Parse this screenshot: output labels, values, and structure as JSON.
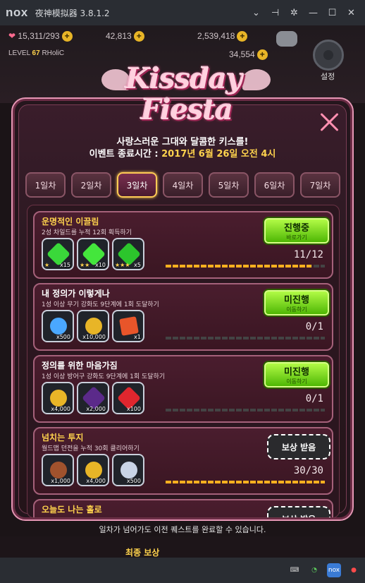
{
  "titlebar": {
    "logo": "nox",
    "title": "夜神模拟器 3.8.1.2",
    "icons": [
      "chevron-down-icon",
      "pin-icon",
      "gear-icon",
      "minimize-icon",
      "maximize-icon",
      "close-icon"
    ]
  },
  "hud": {
    "stamina": "15,311/293",
    "gold": "42,813",
    "gems": "2,539,418",
    "level_label": "LEVEL",
    "level": "67",
    "player_name": "RHoliC",
    "secondary": "34,554",
    "settings_label": "설정"
  },
  "modal": {
    "logo_line1": "Kissday",
    "logo_line2": "Fiesta",
    "subtitle": "사랑스러운 그대와 달콤한 키스를!",
    "event_end_label": "이벤트 종료시간 :",
    "event_end_date": "2017년 6월 26일 오전 4시",
    "tabs": [
      {
        "label": "1일차",
        "active": false
      },
      {
        "label": "2일차",
        "active": false
      },
      {
        "label": "3일차",
        "active": true
      },
      {
        "label": "4일차",
        "active": false
      },
      {
        "label": "5일차",
        "active": false
      },
      {
        "label": "6일차",
        "active": false
      },
      {
        "label": "7일차",
        "active": false
      }
    ],
    "quests": [
      {
        "title": "운명적인 이끌림",
        "title_gold": true,
        "desc": "2성 차일드를 누적 12회 획득하기",
        "rewards": [
          {
            "icon": "green-gem-icon",
            "qty": "x15",
            "stars": "★"
          },
          {
            "icon": "green-gem-icon",
            "qty": "x10",
            "stars": "★★"
          },
          {
            "icon": "green-gem-icon",
            "qty": "x5",
            "stars": "★★★"
          }
        ],
        "button": {
          "type": "green",
          "label": "진행중",
          "sub": "바로가기"
        },
        "progress_text": "11/12",
        "progress": 0.917
      },
      {
        "title": "내 정의가 이렇게나",
        "title_gold": false,
        "desc": "1성 이상 무기 강화도 9단계에 1회 도달하기",
        "rewards": [
          {
            "icon": "blue-stone-icon",
            "qty": "x500",
            "stars": ""
          },
          {
            "icon": "gold-coin-icon",
            "qty": "x10,000",
            "stars": ""
          },
          {
            "icon": "ticket-icon",
            "qty": "x1",
            "stars": ""
          }
        ],
        "button": {
          "type": "green",
          "label": "미진행",
          "sub": "이동하기"
        },
        "progress_text": "0/1",
        "progress": 0
      },
      {
        "title": "정의를 위한 마음가짐",
        "title_gold": false,
        "desc": "1성 이상 방어구 강화도 9단계에 1회 도달하기",
        "rewards": [
          {
            "icon": "gold-coin-icon",
            "qty": "x4,000",
            "stars": ""
          },
          {
            "icon": "purple-crystal-icon",
            "qty": "x2,000",
            "stars": ""
          },
          {
            "icon": "heart-icon",
            "qty": "x100",
            "stars": ""
          }
        ],
        "button": {
          "type": "green",
          "label": "미진행",
          "sub": "이동하기"
        },
        "progress_text": "0/1",
        "progress": 0
      },
      {
        "title": "넘치는 투지",
        "title_gold": true,
        "desc": "월드맵 던전을 누적 30회 클리어하기",
        "rewards": [
          {
            "icon": "bronze-medal-icon",
            "qty": "x1,000",
            "stars": ""
          },
          {
            "icon": "gold-coin-icon",
            "qty": "x4,000",
            "stars": ""
          },
          {
            "icon": "silver-coin-icon",
            "qty": "x500",
            "stars": ""
          }
        ],
        "button": {
          "type": "white",
          "label": "보상 받음",
          "sub": ""
        },
        "progress_text": "30/30",
        "progress": 1
      },
      {
        "title": "오늘도 나는 홀로",
        "title_gold": true,
        "desc": "",
        "rewards": [],
        "button": {
          "type": "white",
          "label": "보상 받음",
          "sub": ""
        },
        "progress_text": "",
        "progress": 1
      }
    ],
    "footer_note": "일차가 넘어가도 이전 퀘스트를 완료할 수 있습니다.",
    "final_reward_label": "최종 보상"
  },
  "colors": {
    "accent_gold": "#ffd34d",
    "button_green": "#6ee01a",
    "modal_border": "#e596b4"
  }
}
